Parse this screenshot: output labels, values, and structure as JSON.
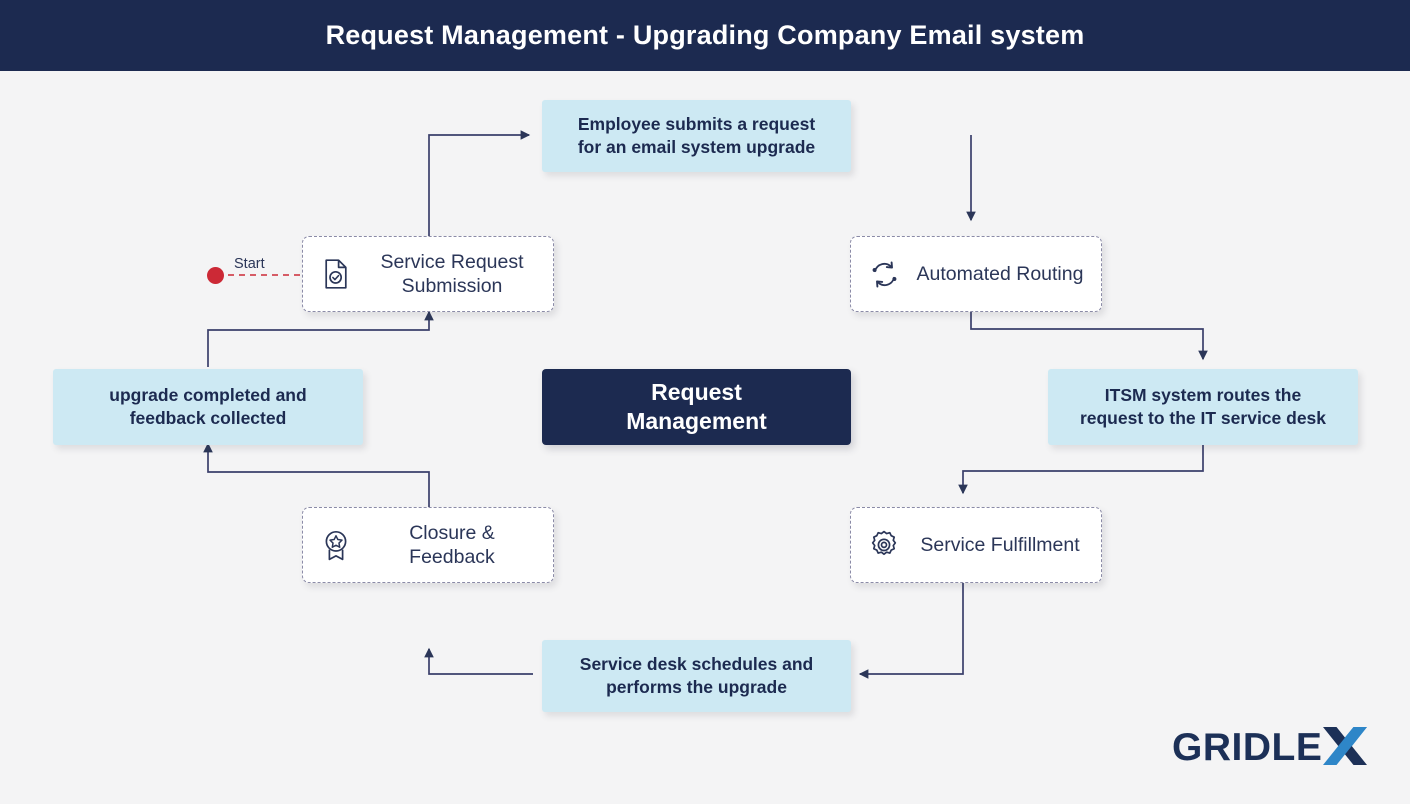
{
  "header": {
    "title": "Request Management - Upgrading Company Email system"
  },
  "colors": {
    "header_bg": "#1c2a50",
    "canvas_bg": "#f4f4f5",
    "event_box": "#cde9f3",
    "event_text": "#1c2a50",
    "process_border": "#8b8ba7",
    "process_text": "#2b3658",
    "hub_bg": "#1c2a50",
    "hub_text": "#ffffff",
    "connector": "#3a3f6b",
    "start_marker": "#cc2936",
    "logo_navy": "#1c3057",
    "logo_blue": "#2e86c8"
  },
  "start": {
    "label": "Start"
  },
  "hub": {
    "label": "Request\nManagement",
    "line1": "Request",
    "line2": "Management"
  },
  "process_nodes": [
    {
      "id": "service-request-submission",
      "icon": "document-check-icon",
      "line1": "Service Request",
      "line2": "Submission"
    },
    {
      "id": "automated-routing",
      "icon": "sync-refresh-icon",
      "line1": "Automated Routing",
      "line2": ""
    },
    {
      "id": "closure-and-feedback",
      "icon": "award-badge-icon",
      "line1": "Closure & Feedback",
      "line2": ""
    },
    {
      "id": "service-fulfillment",
      "icon": "gear-icon",
      "line1": "Service Fulfillment",
      "line2": ""
    }
  ],
  "event_nodes": [
    {
      "id": "employee-submits-request",
      "line1": "Employee submits a request",
      "line2": "for an email system upgrade"
    },
    {
      "id": "itsm-routes-request",
      "line1": "ITSM system routes the",
      "line2": "request to the IT service desk"
    },
    {
      "id": "service-desk-performs-upgrade",
      "line1": "Service desk schedules and",
      "line2": "performs the upgrade"
    },
    {
      "id": "upgrade-completed-feedback",
      "line1": "upgrade completed and",
      "line2": "feedback collected"
    }
  ],
  "logo": {
    "text_main": "GRIDLE",
    "text_accent": "X"
  }
}
